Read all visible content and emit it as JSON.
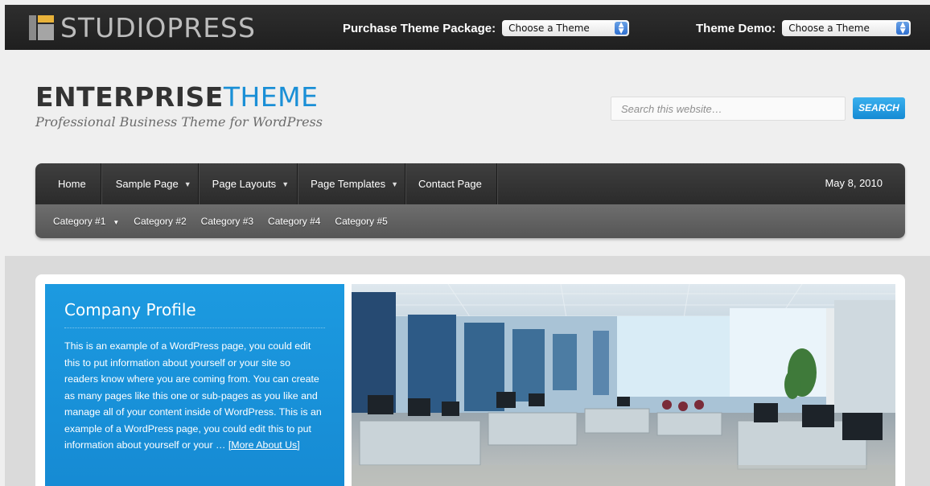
{
  "topbar": {
    "logo_text": "STUDIOPRESS",
    "purchase_label": "Purchase Theme Package:",
    "purchase_select": "Choose a Theme",
    "demo_label": "Theme Demo:",
    "demo_select": "Choose a Theme"
  },
  "header": {
    "title_bold": "ENTERPRISE",
    "title_light": "THEME",
    "tagline": "Professional Business Theme for WordPress",
    "search_placeholder": "Search this website…",
    "search_button": "SEARCH"
  },
  "nav": {
    "items": [
      {
        "label": "Home"
      },
      {
        "label": "Sample Page"
      },
      {
        "label": "Page Layouts"
      },
      {
        "label": "Page Templates"
      },
      {
        "label": "Contact Page"
      }
    ],
    "date": "May 8, 2010",
    "categories": [
      "Category #1",
      "Category #2",
      "Category #3",
      "Category #4",
      "Category #5"
    ]
  },
  "profile": {
    "title": "Company Profile",
    "body": "This is an example of a WordPress page, you could edit this to put information about yourself or your site so readers know where you are coming from. You can create as many pages like this one or sub-pages as you like and manage all of your content inside of WordPress. This is an example of a WordPress page, you could edit this to put information about yourself or your … ",
    "more_link": "[More About Us]"
  },
  "colors": {
    "accent": "#1a8fd6",
    "topbar": "#262626",
    "nav_primary": "#333333",
    "nav_secondary": "#626262"
  }
}
